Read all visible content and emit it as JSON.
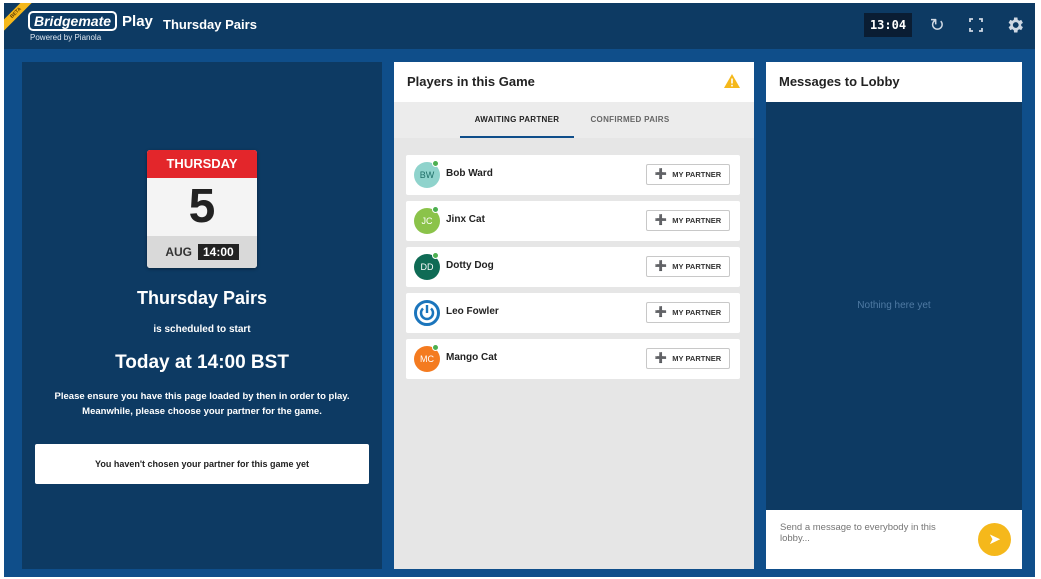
{
  "header": {
    "ribbon_text": "BETA",
    "logo_text": "Bridgemate",
    "logo_play": "Play",
    "powered_by": "Powered by Pianola",
    "event_title": "Thursday Pairs",
    "clock": "13:04",
    "icons": [
      "refresh-icon",
      "fullscreen-icon",
      "settings-gear-icon"
    ]
  },
  "event": {
    "weekday": "THURSDAY",
    "day": "5",
    "month": "AUG",
    "time": "14:00",
    "name": "Thursday Pairs",
    "scheduled_text": "is scheduled to start",
    "start_text": "Today at 14:00 BST",
    "instructions": "Please ensure you have this page loaded by then in order to play. Meanwhile, please choose your partner for the game.",
    "partner_status": "You haven't chosen your partner for this game yet"
  },
  "players_panel": {
    "title": "Players in this Game",
    "tabs": [
      "AWAITING PARTNER",
      "CONFIRMED PAIRS"
    ],
    "button_label": "MY PARTNER",
    "players": [
      {
        "initials": "BW",
        "name": "Bob Ward",
        "color": "#8fd3cc"
      },
      {
        "initials": "JC",
        "name": "Jinx Cat",
        "color": "#8bc34a"
      },
      {
        "initials": "DD",
        "name": "Dotty Dog",
        "color": "#0f6b55"
      },
      {
        "initials": "",
        "name": "Leo Fowler",
        "color": "#1b75bc"
      },
      {
        "initials": "MC",
        "name": "Mango Cat",
        "color": "#f47b20"
      }
    ]
  },
  "messages_panel": {
    "title": "Messages to Lobby",
    "empty_text": "Nothing here yet",
    "placeholder": "Send a message to everybody in this lobby..."
  },
  "colors": {
    "frame": "#0f4e8a",
    "panel_dark": "#0d3a63",
    "calendar_red": "#e3262b",
    "accent_yellow": "#f5b81b"
  }
}
